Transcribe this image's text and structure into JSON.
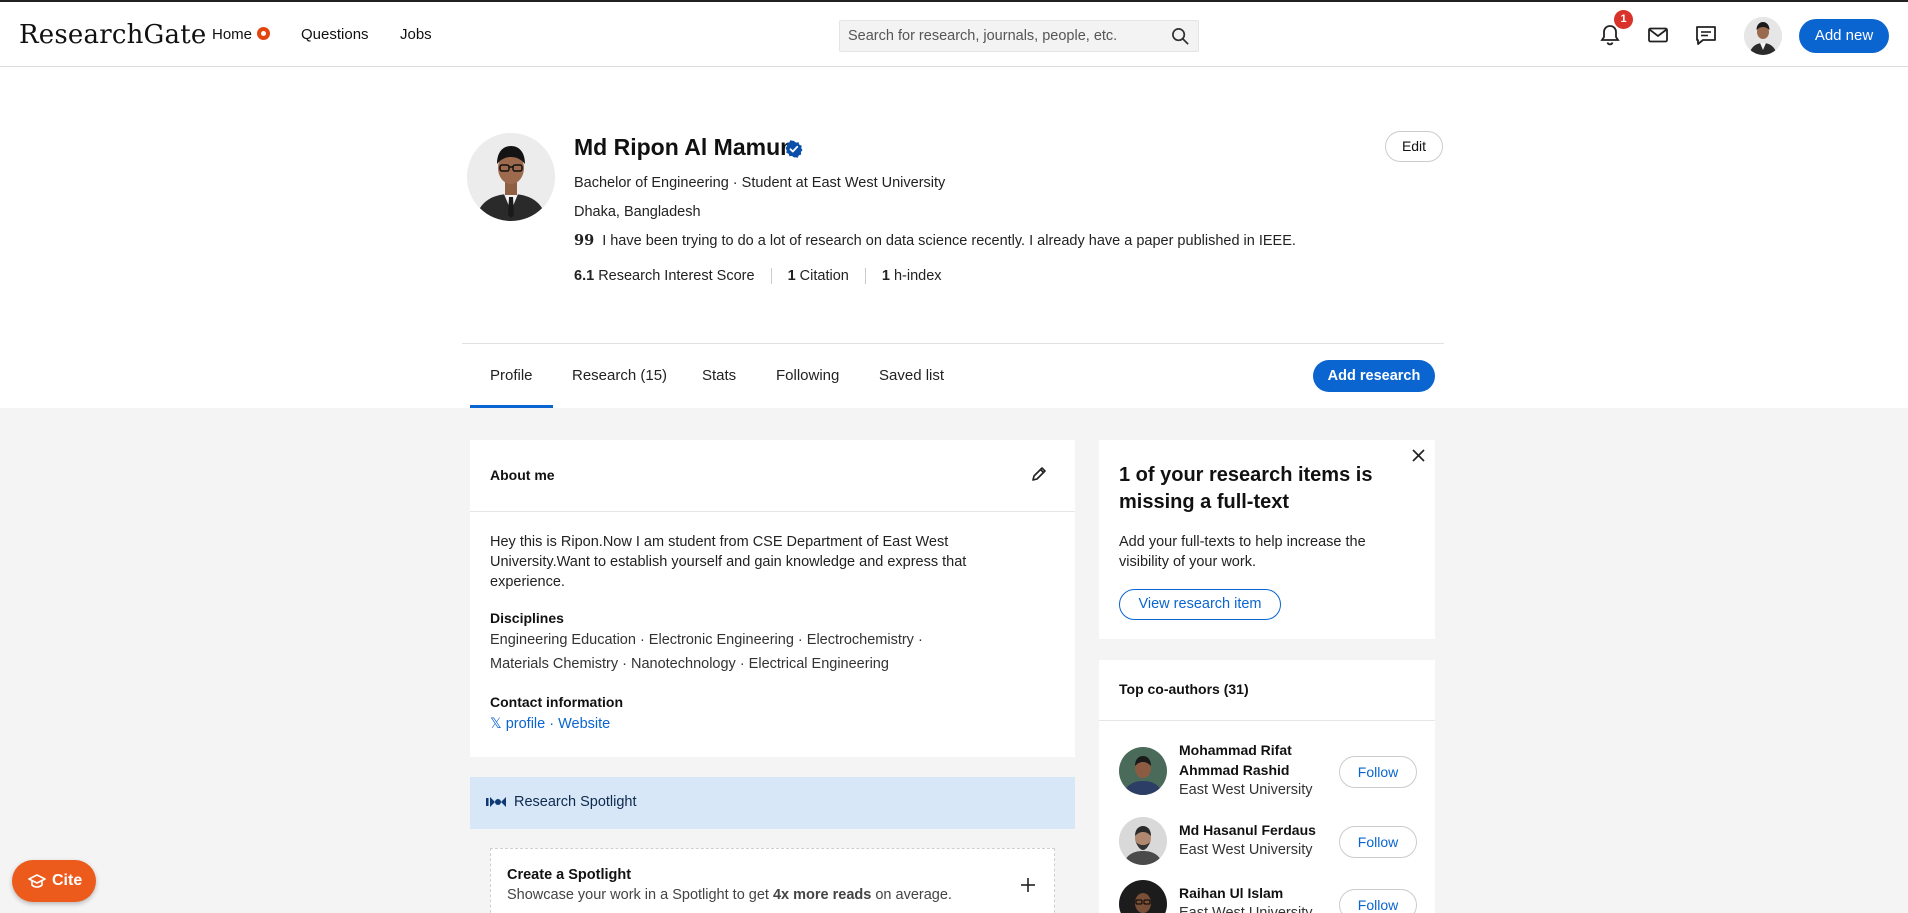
{
  "app": {
    "logo": "ResearchGate"
  },
  "nav": {
    "home": "Home",
    "questions": "Questions",
    "jobs": "Jobs",
    "search_placeholder": "Search for research, journals, people, etc.",
    "notification_count": "1",
    "add_new": "Add new"
  },
  "profile": {
    "name": "Md Ripon Al Mamun",
    "title": "Bachelor of Engineering · Student at East West University",
    "location": "Dhaka, Bangladesh",
    "quote_mark": "99",
    "quote": "I have been trying to do a lot of research on data science recently. I already have a paper published in IEEE.",
    "stats": [
      {
        "value": "6.1",
        "label": "Research Interest Score"
      },
      {
        "value": "1",
        "label": "Citation"
      },
      {
        "value": "1",
        "label": "h-index"
      }
    ],
    "edit_label": "Edit"
  },
  "tabs": [
    "Profile",
    "Research (15)",
    "Stats",
    "Following",
    "Saved list"
  ],
  "add_research": "Add research",
  "about": {
    "title": "About me",
    "text": "Hey this is Ripon.Now I am student from CSE Department of East West University.Want to establish yourself and gain knowledge and express that experience.",
    "disciplines_heading": "Disciplines",
    "disciplines_line1": "Engineering Education · Electronic Engineering · Electrochemistry ·",
    "disciplines_line2": "Materials Chemistry · Nanotechnology · Electrical Engineering",
    "contact_heading": "Contact information",
    "contact_x_icon": "𝕏",
    "contact_profile": "profile",
    "contact_sep": "·",
    "contact_website": "Website"
  },
  "spotlight": {
    "title": "Research Spotlight",
    "create_title": "Create a Spotlight",
    "create_desc_pre": "Showcase your work in a Spotlight to get ",
    "create_desc_bold": "4x more reads",
    "create_desc_post": " on average."
  },
  "fulltext": {
    "title": "1 of your research items is missing a full-text",
    "desc": "Add your full-texts to help increase the visibility of your work.",
    "button": "View research item"
  },
  "coauthors": {
    "title": "Top co-authors (31)",
    "follow_label": "Follow",
    "items": [
      {
        "name": "Mohammad Rifat Ahmmad Rashid",
        "institution": "East West University"
      },
      {
        "name": "Md Hasanul Ferdaus",
        "institution": "East West University"
      },
      {
        "name": "Raihan Ul Islam",
        "institution": "East West University"
      }
    ]
  },
  "cite": {
    "label": "Cite"
  },
  "colors": {
    "accent": "#0a65d0",
    "cite": "#ec5a1c",
    "badge": "#d8322a",
    "spotlight_bg": "#d8e7f7"
  }
}
